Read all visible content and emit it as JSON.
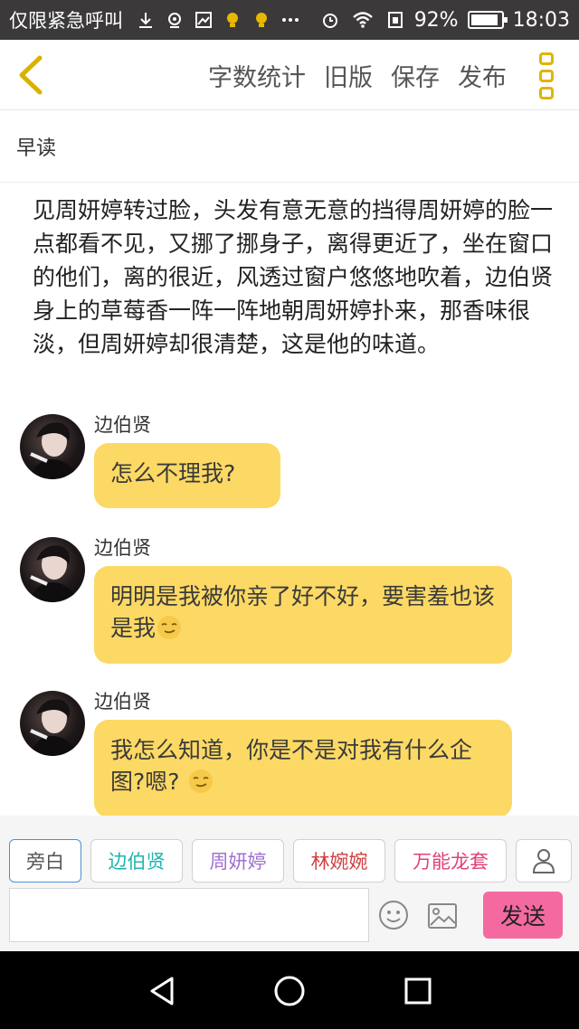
{
  "status_bar": {
    "carrier_text": "仅限紧急呼叫",
    "battery_percent": "92%",
    "battery_level": 0.92,
    "time": "18:03",
    "icons": [
      "download-icon",
      "location-icon",
      "image-icon",
      "bulb-icon",
      "bulb-icon",
      "more-notifications-icon",
      "alarm-icon",
      "wifi-icon",
      "sim-icon",
      "battery-icon"
    ]
  },
  "header": {
    "back_icon": "chevron-left-icon",
    "actions": [
      "字数统计",
      "旧版",
      "保存",
      "发布"
    ],
    "more_icon": "vertical-menu-icon",
    "accent_color": "#e0b400"
  },
  "document": {
    "title": "早读",
    "narration": "见周妍婷转过脸，头发有意无意的挡得周妍婷的脸一点都看不见，又挪了挪身子，离得更近了，坐在窗口的他们，离的很近，风透过窗户悠悠地吹着，边伯贤身上的草莓香一阵一阵地朝周妍婷扑来，那香味很淡，但周妍婷却很清楚，这是他的味道。"
  },
  "messages": [
    {
      "speaker": "边伯贤",
      "text": "怎么不理我?",
      "emoji": ""
    },
    {
      "speaker": "边伯贤",
      "text": "明明是我被你亲了好不好，要害羞也该是我",
      "emoji": "smirk-emoji"
    },
    {
      "speaker": "边伯贤",
      "text": "我怎么知道，你是不是对我有什么企图?嗯? ",
      "emoji": "smirk-emoji"
    }
  ],
  "bubble_color": "#fcd964",
  "roles": [
    {
      "label": "旁白",
      "color": "#555555",
      "border": "#4a90d9"
    },
    {
      "label": "边伯贤",
      "color": "#1fb5b0",
      "border": "#d0d0d0"
    },
    {
      "label": "周妍婷",
      "color": "#a070d0",
      "border": "#d0d0d0"
    },
    {
      "label": "林婉婉",
      "color": "#d04040",
      "border": "#d0d0d0"
    },
    {
      "label": "万能龙套",
      "color": "#e0407a",
      "border": "#d0d0d0"
    }
  ],
  "composer": {
    "input_value": "",
    "emoji_icon": "smiley-icon",
    "image_icon": "picture-icon",
    "send_label": "发送",
    "send_color": "#f46aa0",
    "add_role_icon": "person-icon"
  },
  "nav_bar": {
    "icons": [
      "back-triangle-icon",
      "home-circle-icon",
      "recents-square-icon"
    ]
  }
}
